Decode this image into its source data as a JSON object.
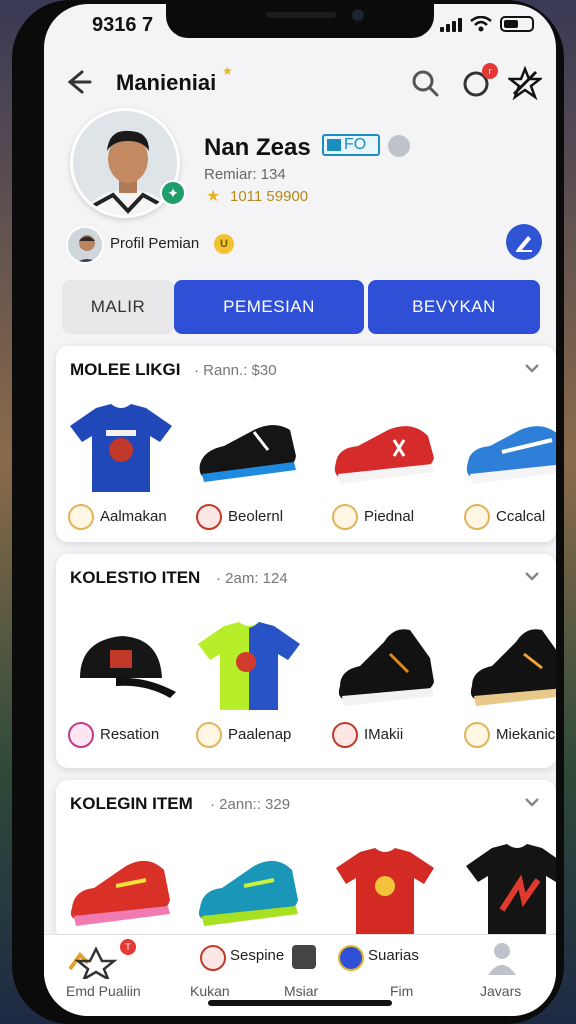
{
  "status_bar": {
    "time": "9316 7"
  },
  "header": {
    "title": "Manieniai"
  },
  "profile": {
    "name": "Nan Zeas",
    "badge": "FO",
    "subtitle": "Remiar: 134",
    "points": "1011 59900",
    "link_label": "Profil Pemian",
    "coin": "U"
  },
  "tabs": [
    {
      "label": "MALIR",
      "active": false
    },
    {
      "label": "PEMESIAN",
      "active": true
    },
    {
      "label": "BEVYKAN",
      "active": true
    }
  ],
  "sections": [
    {
      "title": "MOLEE LIKGI",
      "meta": "· Rann.: $30",
      "items": [
        {
          "label": "Aalmakan",
          "icon": "jersey-blue"
        },
        {
          "label": "Beolernl",
          "icon": "boot-black-blue"
        },
        {
          "label": "Piednal",
          "icon": "sneaker-red"
        },
        {
          "label": "Ccalcal",
          "icon": "sneaker-blue"
        }
      ]
    },
    {
      "title": "KOLESTIO ITEN",
      "meta": "· 2am: 124",
      "items": [
        {
          "label": "Resation",
          "icon": "cap-black"
        },
        {
          "label": "Paalenap",
          "icon": "jersey-green"
        },
        {
          "label": "IMakii",
          "icon": "boot-black"
        },
        {
          "label": "Miekanic",
          "icon": "boot-black-orange"
        }
      ]
    },
    {
      "title": "KOLEGIN ITEM",
      "meta": "· 2ann:: 329",
      "items": [
        {
          "label": "",
          "icon": "boot-red"
        },
        {
          "label": "",
          "icon": "boot-teal"
        },
        {
          "label": "",
          "icon": "jersey-red"
        },
        {
          "label": "",
          "icon": "jersey-black"
        }
      ]
    }
  ],
  "bottom_nav": {
    "items": [
      "Emd Pualiin",
      "Kukan",
      "Msiar",
      "Fim",
      "Javars"
    ],
    "top_labels": [
      "Sespine",
      "Suarias"
    ],
    "notification_count": "T"
  },
  "colors": {
    "accent": "#2f4fd6",
    "gold": "#e6b32a",
    "badge_red": "#e53935"
  }
}
